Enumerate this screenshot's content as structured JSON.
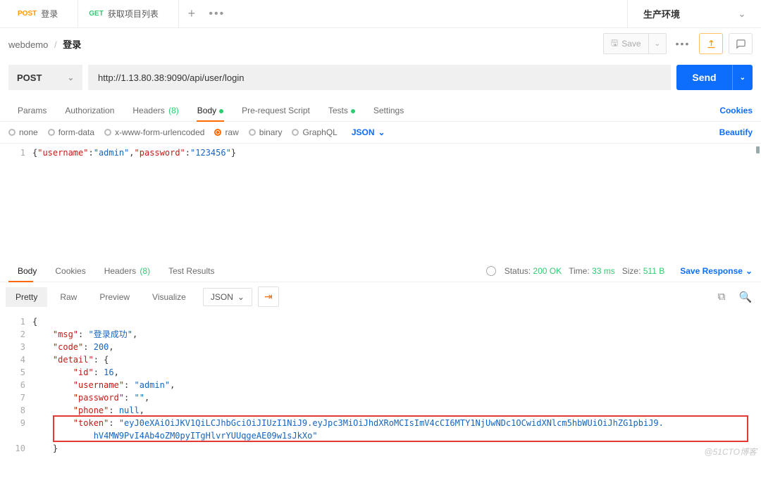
{
  "tabs": [
    {
      "method": "POST",
      "label": "登录"
    },
    {
      "method": "GET",
      "label": "获取项目列表"
    }
  ],
  "environment": "生产环境",
  "breadcrumb": {
    "root": "webdemo",
    "current": "登录"
  },
  "save_label": "Save",
  "request": {
    "method": "POST",
    "url": "http://1.13.80.38:9090/api/user/login",
    "send": "Send"
  },
  "req_tabs": {
    "params": "Params",
    "authorization": "Authorization",
    "headers": "Headers",
    "headers_count": "(8)",
    "body": "Body",
    "prerequest": "Pre-request Script",
    "tests": "Tests",
    "settings": "Settings",
    "cookies": "Cookies"
  },
  "body_types": {
    "none": "none",
    "formdata": "form-data",
    "xform": "x-www-form-urlencoded",
    "raw": "raw",
    "binary": "binary",
    "graphql": "GraphQL",
    "json": "JSON",
    "beautify": "Beautify"
  },
  "req_body_html": "<span class=\"p\">{</span><span class=\"k\">\"username\"</span><span class=\"p\">:</span><span class=\"s\">\"admin\"</span><span class=\"p\">,</span><span class=\"k\">\"password\"</span><span class=\"p\">:</span><span class=\"s\">\"123456\"</span><span class=\"p\">}</span>",
  "resp_tabs": {
    "body": "Body",
    "cookies": "Cookies",
    "headers": "Headers",
    "headers_count": "(8)",
    "testresults": "Test Results"
  },
  "status": {
    "status_label": "Status:",
    "status_value": "200 OK",
    "time_label": "Time:",
    "time_value": "33 ms",
    "size_label": "Size:",
    "size_value": "511 B",
    "save_response": "Save Response"
  },
  "view_tabs": {
    "pretty": "Pretty",
    "raw": "Raw",
    "preview": "Preview",
    "visualize": "Visualize",
    "json": "JSON"
  },
  "response_lines": [
    {
      "n": 1,
      "html": "<span class=\"p\">{</span>"
    },
    {
      "n": 2,
      "html": "&nbsp;&nbsp;&nbsp;&nbsp;<span class=\"k\">\"msg\"</span><span class=\"p\">: </span><span class=\"s\">\"登录成功\"</span><span class=\"p\">,</span>"
    },
    {
      "n": 3,
      "html": "&nbsp;&nbsp;&nbsp;&nbsp;<span class=\"k\">\"code\"</span><span class=\"p\">: </span><span class=\"n\">200</span><span class=\"p\">,</span>"
    },
    {
      "n": 4,
      "html": "&nbsp;&nbsp;&nbsp;&nbsp;<span class=\"k\">\"detail\"</span><span class=\"p\">: {</span>"
    },
    {
      "n": 5,
      "html": "&nbsp;&nbsp;&nbsp;&nbsp;&nbsp;&nbsp;&nbsp;&nbsp;<span class=\"k\">\"id\"</span><span class=\"p\">: </span><span class=\"n\">16</span><span class=\"p\">,</span>"
    },
    {
      "n": 6,
      "html": "&nbsp;&nbsp;&nbsp;&nbsp;&nbsp;&nbsp;&nbsp;&nbsp;<span class=\"k\">\"username\"</span><span class=\"p\">: </span><span class=\"s\">\"admin\"</span><span class=\"p\">,</span>"
    },
    {
      "n": 7,
      "html": "&nbsp;&nbsp;&nbsp;&nbsp;&nbsp;&nbsp;&nbsp;&nbsp;<span class=\"k\">\"password\"</span><span class=\"p\">: </span><span class=\"s\">\"\"</span><span class=\"p\">,</span>"
    },
    {
      "n": 8,
      "html": "&nbsp;&nbsp;&nbsp;&nbsp;&nbsp;&nbsp;&nbsp;&nbsp;<span class=\"k\">\"phone\"</span><span class=\"p\">: </span><span class=\"n\">null</span><span class=\"p\">,</span>"
    },
    {
      "n": 9,
      "html": "&nbsp;&nbsp;&nbsp;&nbsp;&nbsp;&nbsp;&nbsp;&nbsp;<span class=\"k\">\"token\"</span><span class=\"p\">: </span><span class=\"s\">\"eyJ0eXAiOiJKV1QiLCJhbGciOiJIUzI1NiJ9.eyJpc3MiOiJhdXRoMCIsImV4cCI6MTY1NjUwNDc1OCwidXNlcm5hbWUiOiJhZG1pbiJ9.<br>&nbsp;&nbsp;&nbsp;&nbsp;&nbsp;&nbsp;&nbsp;&nbsp;&nbsp;&nbsp;&nbsp;&nbsp;hV4MW9PvI4Ab4oZM0pyITgHlvrYUUqgeAE09w1sJkXo\"</span>"
    },
    {
      "n": 10,
      "html": "&nbsp;&nbsp;&nbsp;&nbsp;<span class=\"p\">}</span>"
    }
  ],
  "watermark": "@51CTO博客"
}
